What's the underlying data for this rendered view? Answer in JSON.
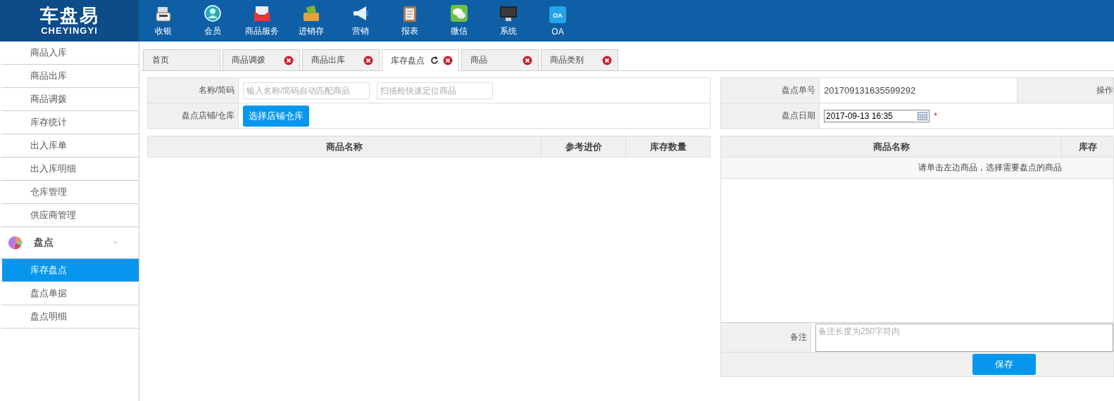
{
  "header": {
    "logo": {
      "title": "车盘易",
      "subtitle": "CHEYINGYI"
    },
    "nav": [
      {
        "label": "收银",
        "kind": "register"
      },
      {
        "label": "会员",
        "kind": "member"
      },
      {
        "label": "商品服务",
        "kind": "mail"
      },
      {
        "label": "进销存",
        "kind": "box"
      },
      {
        "label": "营销",
        "kind": "megaphone"
      },
      {
        "label": "报表",
        "kind": "clipboard"
      },
      {
        "label": "微信",
        "kind": "chat"
      },
      {
        "label": "系统",
        "kind": "monitor"
      },
      {
        "label": "OA",
        "kind": "badge",
        "badge": "OA"
      }
    ]
  },
  "sidebar": {
    "items": [
      {
        "label": "商品入库"
      },
      {
        "label": "商品出库"
      },
      {
        "label": "商品调拨"
      },
      {
        "label": "库存统计"
      },
      {
        "label": "出入库单"
      },
      {
        "label": "出入库明细"
      },
      {
        "label": "仓库管理"
      },
      {
        "label": "供应商管理"
      }
    ],
    "group": {
      "label": "盘点",
      "expanded": true,
      "children": [
        {
          "label": "库存盘点",
          "selected": true
        },
        {
          "label": "盘点单据",
          "selected": false
        },
        {
          "label": "盘点明细",
          "selected": false
        }
      ]
    }
  },
  "tabs": [
    {
      "label": "首页",
      "selected": false,
      "closable": false
    },
    {
      "label": "商品调拨",
      "selected": false,
      "closable": true
    },
    {
      "label": "商品出库",
      "selected": false,
      "closable": true
    },
    {
      "label": "库存盘点",
      "selected": true,
      "closable": true
    },
    {
      "label": "商品",
      "selected": false,
      "closable": true
    },
    {
      "label": "商品类别",
      "selected": false,
      "closable": true
    }
  ],
  "left": {
    "name_label": "名称/简码",
    "name_placeholder": "输入名称/简码自动匹配商品",
    "scan_placeholder": "扫描枪快速定位商品",
    "store_label": "盘点店铺/仓库",
    "store_button": "选择店铺仓库",
    "columns": [
      "商品名称",
      "参考进价",
      "库存数量"
    ]
  },
  "right": {
    "order_label": "盘点单号",
    "order_value": "201709131635599292",
    "operator_label": "操作",
    "date_label": "盘点日期",
    "date_value": "2017-09-13 16:35",
    "required_mark": "*",
    "columns": [
      "商品名称",
      "库存"
    ],
    "empty_message": "请单击左边商品，选择需要盘点的商品",
    "remark_label": "备注",
    "remark_placeholder": "备注长度为250字符内",
    "save_button": "保存"
  }
}
